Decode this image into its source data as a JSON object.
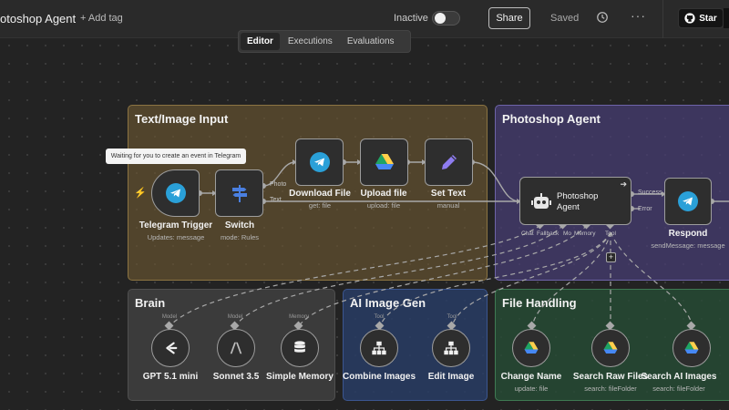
{
  "header": {
    "workflow_name": "otoshop Agent",
    "add_tag": "+ Add tag",
    "status_label": "Inactive",
    "share_label": "Share",
    "saved_label": "Saved",
    "more_label": "···",
    "star_label": "Star"
  },
  "tabs": [
    {
      "label": "Editor",
      "active": true
    },
    {
      "label": "Executions",
      "active": false
    },
    {
      "label": "Evaluations",
      "active": false
    }
  ],
  "groups": {
    "input": {
      "title": "Text/Image Input",
      "color": "#6e5832"
    },
    "agent": {
      "title": "Photoshop Agent",
      "color": "#483e76"
    },
    "brain": {
      "title": "Brain",
      "color": "#3b3b3b"
    },
    "imggen": {
      "title": "AI Image Gen",
      "color": "#283c64"
    },
    "file": {
      "title": "File Handling",
      "color": "#264c34"
    }
  },
  "tooltip": "Waiting for you to create an event in Telegram",
  "nodes": {
    "telegram_trigger": {
      "label": "Telegram Trigger",
      "sub": "Updates: message",
      "icon": "telegram-icon"
    },
    "switch": {
      "label": "Switch",
      "sub": "mode: Rules",
      "icon": "signpost-icon",
      "outputs": [
        "Photo",
        "Text"
      ]
    },
    "download_file": {
      "label": "Download File",
      "sub": "get: file",
      "icon": "telegram-icon"
    },
    "upload_file": {
      "label": "Upload file",
      "sub": "upload: file",
      "icon": "google-drive-icon"
    },
    "set_text": {
      "label": "Set Text",
      "sub": "manual",
      "icon": "pencil-icon"
    },
    "photoshop_agent": {
      "label": "Photoshop Agent",
      "icon": "robot-icon",
      "outputs": [
        "Success",
        "Error"
      ],
      "inputs": [
        "Chat",
        "Fallback",
        "Mo",
        "Memory",
        "Tool"
      ]
    },
    "respond": {
      "label": "Respond",
      "sub": "sendMessage: message",
      "icon": "telegram-icon"
    },
    "gpt": {
      "label": "GPT 5.1 mini",
      "port": "Model",
      "icon": "openai-icon"
    },
    "sonnet": {
      "label": "Sonnet 3.5",
      "port": "Model",
      "icon": "anthropic-icon"
    },
    "memory": {
      "label": "Simple Memory",
      "port": "Memory",
      "icon": "database-icon"
    },
    "combine": {
      "label": "Combine Images",
      "port": "Tool",
      "icon": "sitemap-icon"
    },
    "edit": {
      "label": "Edit Image",
      "port": "Tool",
      "icon": "sitemap-icon"
    },
    "change_name": {
      "label": "Change Name",
      "sub": "update: file",
      "icon": "google-drive-icon"
    },
    "search_raw": {
      "label": "Search Raw Files",
      "sub": "search: fileFolder",
      "icon": "google-drive-icon"
    },
    "search_ai": {
      "label": "Search AI Images",
      "sub": "search: fileFolder",
      "icon": "google-drive-icon"
    }
  },
  "colors": {
    "telegram": "#2aa0d8",
    "drive_green": "#1fa463",
    "drive_yellow": "#ffd04b",
    "drive_blue": "#4688f4",
    "pencil": "#8e7cf0",
    "signpost": "#4a7fe0",
    "trigger_bolt": "#ff6a3d"
  }
}
